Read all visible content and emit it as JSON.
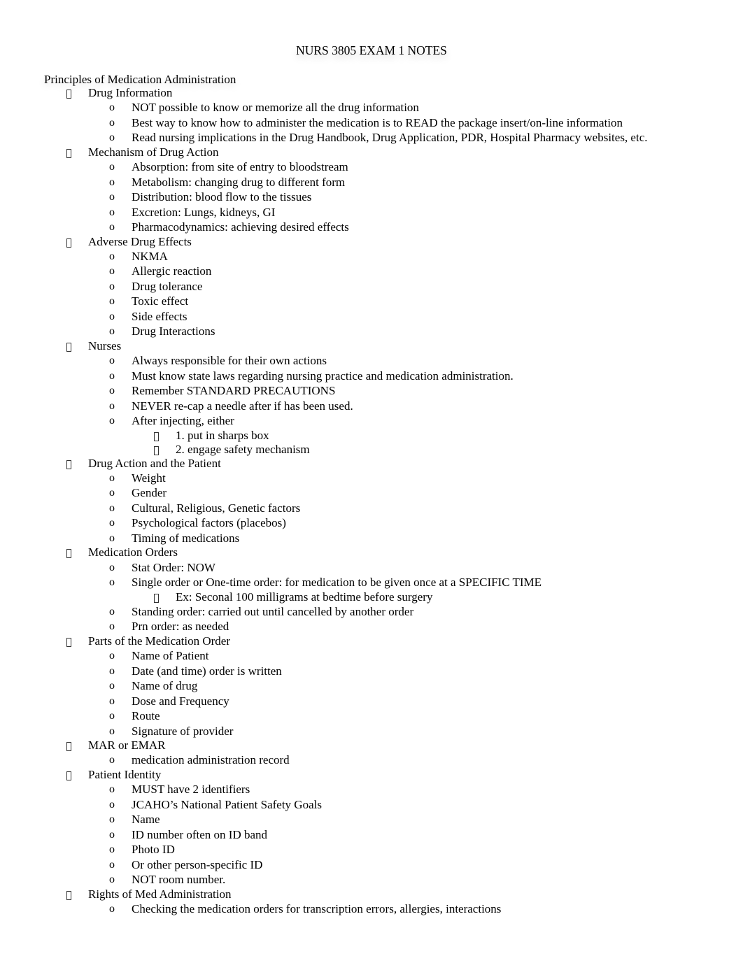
{
  "document": {
    "title": "NURS 3805 EXAM 1 NOTES",
    "heading": "Principles of Medication Administration",
    "sections": [
      {
        "label": "Drug Information",
        "items": [
          {
            "text": "NOT possible to know or memorize all the drug information"
          },
          {
            "text": "Best way to know how to administer the medication is to READ the package insert/on-line information"
          },
          {
            "text": "Read nursing implications in the Drug Handbook, Drug Application, PDR, Hospital Pharmacy websites, etc."
          }
        ]
      },
      {
        "label": "Mechanism of Drug Action",
        "items": [
          {
            "text": "Absorption: from site of entry to bloodstream"
          },
          {
            "text": "Metabolism: changing drug to different form"
          },
          {
            "text": "Distribution: blood flow to the tissues"
          },
          {
            "text": "Excretion: Lungs, kidneys, GI"
          },
          {
            "text": "Pharmacodynamics: achieving desired effects"
          }
        ]
      },
      {
        "label": "Adverse Drug Effects",
        "items": [
          {
            "text": "NKMA"
          },
          {
            "text": "Allergic reaction"
          },
          {
            "text": "Drug tolerance"
          },
          {
            "text": "Toxic effect"
          },
          {
            "text": "Side effects"
          },
          {
            "text": "Drug Interactions"
          }
        ]
      },
      {
        "label": "Nurses",
        "items": [
          {
            "text": "Always responsible for their own actions"
          },
          {
            "text": "Must know state laws regarding nursing practice and medication administration."
          },
          {
            "text": "Remember STANDARD PRECAUTIONS"
          },
          {
            "text": "NEVER re-cap a needle after if has been used."
          },
          {
            "text": "After injecting, either",
            "subitems": [
              "1. put in sharps box",
              "2. engage safety mechanism"
            ]
          }
        ]
      },
      {
        "label": "Drug Action and the Patient",
        "items": [
          {
            "text": "Weight"
          },
          {
            "text": "Gender"
          },
          {
            "text": "Cultural, Religious, Genetic factors"
          },
          {
            "text": "Psychological factors (placebos)"
          },
          {
            "text": "Timing of medications"
          }
        ]
      },
      {
        "label": "Medication Orders",
        "items": [
          {
            "text": "Stat Order: NOW"
          },
          {
            "text": "Single order or One-time order: for medication to be given once at a SPECIFIC TIME",
            "subitems": [
              "Ex: Seconal 100 milligrams at bedtime before surgery"
            ]
          },
          {
            "text": "Standing order: carried out until cancelled by another order"
          },
          {
            "text": "Prn order: as needed"
          }
        ]
      },
      {
        "label": "Parts of the Medication Order",
        "items": [
          {
            "text": "Name of Patient"
          },
          {
            "text": "Date (and time) order is written"
          },
          {
            "text": "Name of drug"
          },
          {
            "text": "Dose and Frequency"
          },
          {
            "text": "Route"
          },
          {
            "text": "Signature of provider"
          }
        ]
      },
      {
        "label": "MAR or EMAR",
        "items": [
          {
            "text": "medication administration record"
          }
        ]
      },
      {
        "label": "Patient Identity",
        "items": [
          {
            "text": "MUST have 2 identifiers"
          },
          {
            "text": "JCAHO’s National Patient Safety Goals"
          },
          {
            "text": "Name"
          },
          {
            "text": "ID number often on ID band"
          },
          {
            "text": "Photo ID"
          },
          {
            "text": "Or other person-specific ID"
          },
          {
            "text": "NOT room number."
          }
        ]
      },
      {
        "label": "Rights of Med Administration",
        "items": [
          {
            "text": "Checking the medication orders for transcription errors, allergies, interactions"
          }
        ]
      }
    ],
    "bullet_level2": "o"
  }
}
